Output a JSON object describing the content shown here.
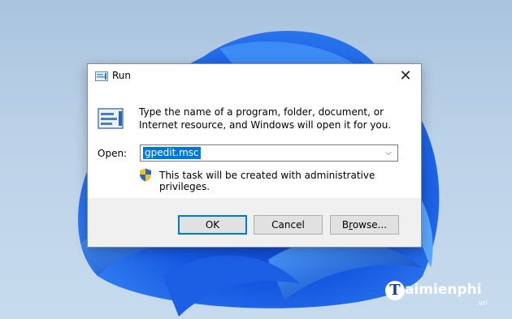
{
  "window": {
    "title": "Run",
    "close_glyph": "✕",
    "icon": "run-icon"
  },
  "dialog": {
    "description": "Type the name of a program, folder, document, or Internet resource, and Windows will open it for you.",
    "open_label": "Open:",
    "open_value": "gpedit.msc",
    "admin_note": "This task will be created with administrative privileges.",
    "shield_icon": "uac-shield-icon"
  },
  "buttons": {
    "ok": "OK",
    "cancel": "Cancel",
    "browse_prefix": "B",
    "browse_underlined": "r",
    "browse_suffix": "owse..."
  },
  "watermark": {
    "logo_letter": "T",
    "brand": "aimienphi",
    "tld": ".vn"
  },
  "colors": {
    "accent": "#0078d7",
    "dialog_bg": "#f0f0f0",
    "button_bg": "#e1e1e1"
  }
}
